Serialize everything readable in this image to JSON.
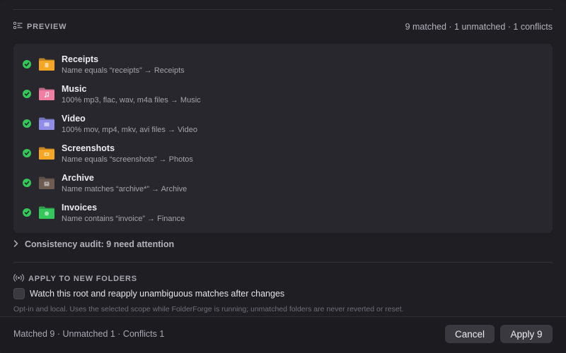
{
  "preview": {
    "title": "PREVIEW",
    "summary": "9 matched · 1 unmatched · 1 conflicts",
    "items": [
      {
        "name": "Receipts",
        "desc": "Name equals “receipts” → Receipts",
        "folder_color": "#f5a623",
        "icon": "receipt-icon"
      },
      {
        "name": "Music",
        "desc": "100% mp3, flac, wav, m4a files → Music",
        "folder_color": "#f07fa3",
        "icon": "music-note-icon"
      },
      {
        "name": "Video",
        "desc": "100% mov, mp4, mkv, avi files → Video",
        "folder_color": "#8f8de8",
        "icon": "video-icon"
      },
      {
        "name": "Screenshots",
        "desc": "Name equals “screenshots” → Photos",
        "folder_color": "#f5a623",
        "icon": "camera-icon"
      },
      {
        "name": "Archive",
        "desc": "Name matches “archive*” → Archive",
        "folder_color": "#6e5c52",
        "icon": "archive-box-icon"
      },
      {
        "name": "Invoices",
        "desc": "Name contains “invoice” → Finance",
        "folder_color": "#34c759",
        "icon": "money-icon"
      }
    ]
  },
  "audit": {
    "label": "Consistency audit: 9 need attention"
  },
  "apply_new": {
    "title": "APPLY TO NEW FOLDERS",
    "watch_label": "Watch this root and reapply unambiguous matches after changes",
    "note": "Opt-in and local. Uses the selected scope while FolderForge is running; unmatched folders are never reverted or reset."
  },
  "footer": {
    "status": "Matched 9 · Unmatched 1 · Conflicts 1",
    "cancel_label": "Cancel",
    "apply_label": "Apply 9"
  },
  "colors": {
    "check_green": "#34c759",
    "background": "#1f1e23",
    "panel": "#28272d"
  }
}
